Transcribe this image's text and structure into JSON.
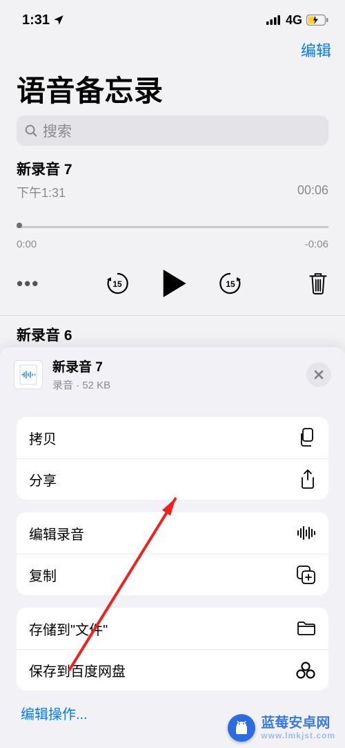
{
  "status": {
    "time": "1:31",
    "network": "4G"
  },
  "nav": {
    "edit": "编辑"
  },
  "page": {
    "title": "语音备忘录"
  },
  "search": {
    "placeholder": "搜索"
  },
  "recording": {
    "title": "新录音 7",
    "subtitle": "下午1:31",
    "duration": "00:06",
    "scrub_left": "0:00",
    "scrub_right": "-0:06"
  },
  "next_recording": {
    "title": "新录音 6"
  },
  "sheet": {
    "title": "新录音 7",
    "subtitle": "录音 · 52 KB",
    "actions": {
      "copy": "拷贝",
      "share": "分享",
      "edit_recording": "编辑录音",
      "duplicate": "复制",
      "save_to_files": "存储到\"文件\"",
      "save_to_baidu": "保存到百度网盘"
    },
    "edit_actions": "编辑操作..."
  },
  "watermark": {
    "brand": "蓝莓安卓网",
    "url": "www.lmkjst.com"
  }
}
